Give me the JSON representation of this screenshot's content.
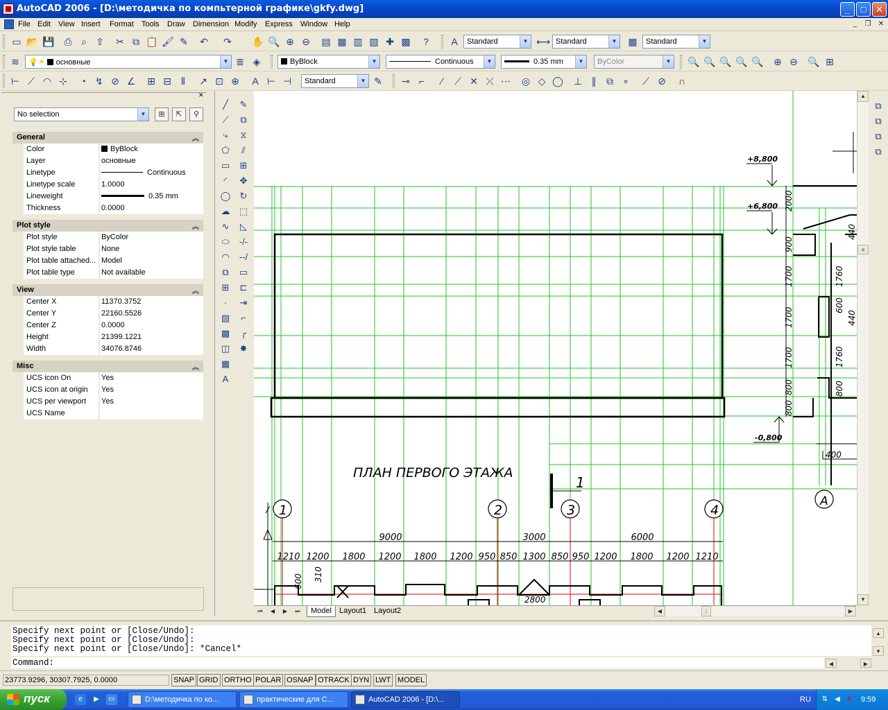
{
  "window": {
    "title": "AutoCAD 2006 - [D:\\методичка по компьтерной графике\\gkfy.dwg]",
    "minimize": "_",
    "maximize": "□",
    "close": "✕"
  },
  "menu": {
    "items": [
      "File",
      "Edit",
      "View",
      "Insert",
      "Format",
      "Tools",
      "Draw",
      "Dimension",
      "Modify",
      "Express",
      "Window",
      "Help"
    ],
    "mdi_min": "_",
    "mdi_restore": "❐",
    "mdi_close": "✕"
  },
  "toolbar": {
    "text_style": "Standard",
    "dim_style": "Standard",
    "table_style": "Standard",
    "layer": "основные",
    "color": "ByBlock",
    "linetype": "Continuous",
    "lineweight": "0.35 mm",
    "plotstyle": "ByColor",
    "dim_combo": "Standard"
  },
  "properties": {
    "selection": "No selection",
    "sections": [
      {
        "title": "General",
        "rows": [
          {
            "key": "Color",
            "value": "ByBlock"
          },
          {
            "key": "Layer",
            "value": "основные"
          },
          {
            "key": "Linetype",
            "value": "Continuous"
          },
          {
            "key": "Linetype scale",
            "value": "1.0000"
          },
          {
            "key": "Lineweight",
            "value": "0.35 mm"
          },
          {
            "key": "Thickness",
            "value": "0.0000"
          }
        ]
      },
      {
        "title": "Plot style",
        "rows": [
          {
            "key": "Plot style",
            "value": "ByColor"
          },
          {
            "key": "Plot style table",
            "value": "None"
          },
          {
            "key": "Plot table attached...",
            "value": "Model"
          },
          {
            "key": "Plot table type",
            "value": "Not available"
          }
        ]
      },
      {
        "title": "View",
        "rows": [
          {
            "key": "Center X",
            "value": "11370.3752"
          },
          {
            "key": "Center Y",
            "value": "22160.5526"
          },
          {
            "key": "Center Z",
            "value": "0.0000"
          },
          {
            "key": "Height",
            "value": "21399.1221"
          },
          {
            "key": "Width",
            "value": "34076.8746"
          }
        ]
      },
      {
        "title": "Misc",
        "rows": [
          {
            "key": "UCS icon On",
            "value": "Yes"
          },
          {
            "key": "UCS icon at origin",
            "value": "Yes"
          },
          {
            "key": "UCS per viewport",
            "value": "Yes"
          },
          {
            "key": "UCS Name",
            "value": ""
          }
        ]
      }
    ]
  },
  "drawing": {
    "plan_title": "ПЛАН ПЕРВОГО ЭТАЖА",
    "section_mark": "1",
    "axes": [
      "1",
      "2",
      "3",
      "4",
      "А"
    ],
    "dims_overall": [
      "9000",
      "3000",
      "6000"
    ],
    "dims_detail": [
      "1210",
      "1200",
      "1800",
      "1200",
      "1800",
      "1200",
      "950",
      "850",
      "1300",
      "850",
      "950",
      "1200",
      "1800",
      "1200",
      "1210"
    ],
    "levels": [
      "+8,800",
      "+6,800",
      "-0,800"
    ],
    "vertical_dims": [
      "2000",
      "900",
      "1700",
      "1700",
      "1700",
      "800",
      "800"
    ],
    "side_dims": [
      "440",
      "1760",
      "600",
      "440",
      "1760",
      "800"
    ],
    "bottom_dims": [
      "400",
      "600",
      "310",
      "2800"
    ],
    "grid_color": "#22c522",
    "axis_line_color": "#e00000"
  },
  "tabs": {
    "items": [
      "Model",
      "Layout1",
      "Layout2"
    ],
    "active": "Model"
  },
  "command": {
    "history": [
      "Specify next point or [Close/Undo]:",
      "Specify next point or [Close/Undo]:",
      "Specify next point or [Close/Undo]: *Cancel*"
    ],
    "prompt": "Command:"
  },
  "status": {
    "coords": "23773.9296, 30307.7925, 0.0000",
    "buttons": [
      "SNAP",
      "GRID",
      "ORTHO",
      "POLAR",
      "OSNAP",
      "OTRACK",
      "DYN",
      "LWT",
      "MODEL"
    ]
  },
  "taskbar": {
    "start": "пуск",
    "tasks": [
      {
        "label": "D:\\методичка по ко...",
        "active": false
      },
      {
        "label": "практические для С...",
        "active": false
      },
      {
        "label": "AutoCAD 2006 - [D:\\...",
        "active": true
      }
    ],
    "lang": "RU",
    "clock": "9:59"
  }
}
